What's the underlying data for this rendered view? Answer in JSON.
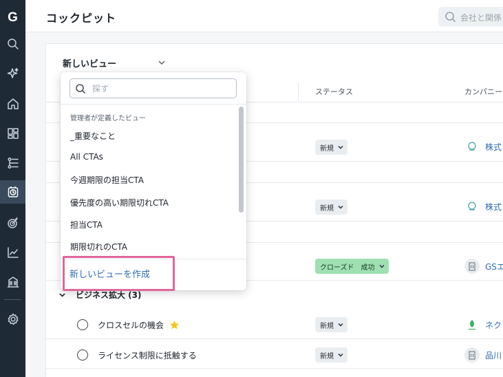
{
  "app": {
    "logo_letter": "G",
    "page_title": "コックピット"
  },
  "header": {
    "search_placeholder": "会社と関係"
  },
  "sidebar": {
    "icons": [
      "search-icon",
      "sparkle-icon",
      "home-icon",
      "dashboard-icon",
      "timeline-icon",
      "cockpit-icon",
      "target-icon",
      "analytics-icon",
      "building-icon",
      "settings-icon"
    ],
    "active": "cockpit-icon"
  },
  "view": {
    "label": "新しいビュー"
  },
  "columns": {
    "status": "ステータス",
    "company": "カンパニー"
  },
  "dropdown": {
    "search_placeholder": "探す",
    "section_label": "管理者が定義したビュー",
    "items": [
      "_重要なこと",
      "All CTAs",
      "今週期限の担当CTA",
      "優先度の高い期限切れCTA",
      "担当CTA",
      "期限切れのCTA"
    ],
    "create_label": "新しいビューを作成"
  },
  "rows": [
    {
      "status": "新規",
      "company": "株式"
    },
    {
      "status": "新規",
      "company": "株式"
    },
    {
      "status": "クローズド　成功",
      "company": "GSエ"
    }
  ],
  "group": {
    "label": "ビジネス拡大 (3)"
  },
  "tasks": [
    {
      "title": "クロスセルの機会",
      "status": "新規",
      "company": "ネク"
    },
    {
      "title": "ライセンス制限に抵触する",
      "status": "新規",
      "company": "品川"
    }
  ],
  "colors": {
    "sidebar_bg": "#1f2a37",
    "link": "#2f6cb5",
    "closed_status": "#9fe0b2",
    "highlight": "#e2669b",
    "star": "#f5c518"
  }
}
